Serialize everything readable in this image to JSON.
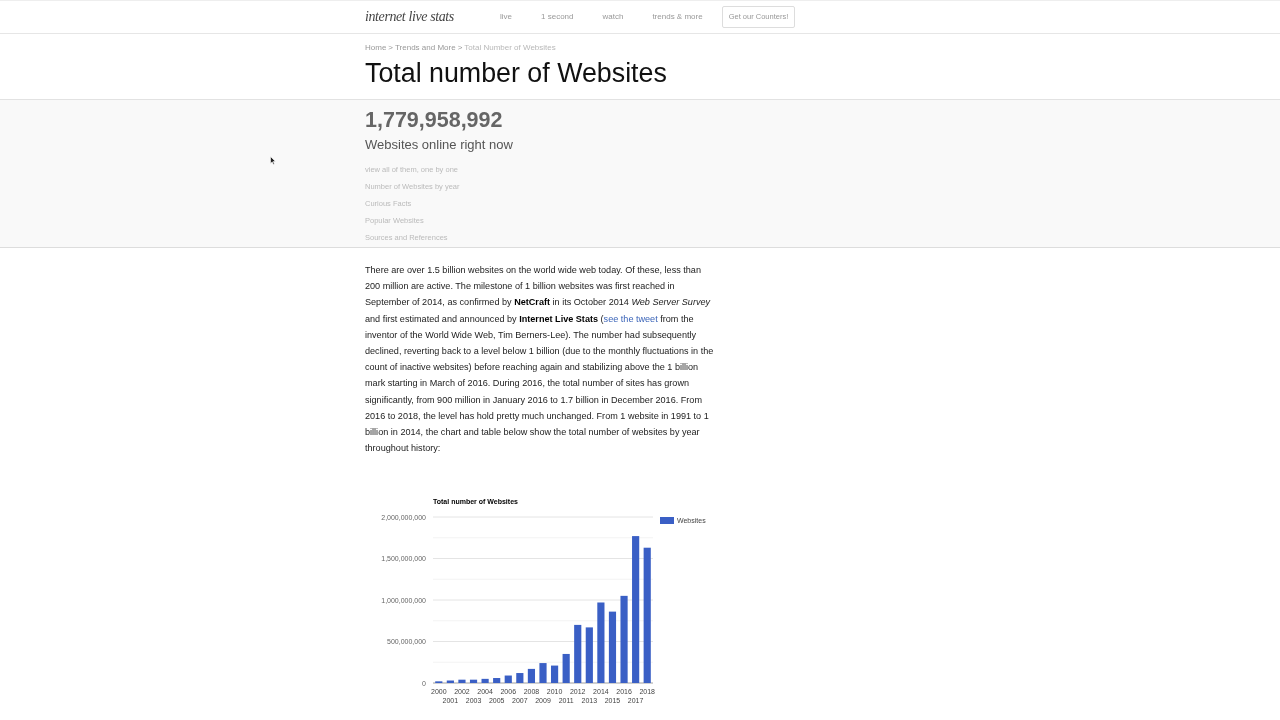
{
  "header": {
    "logo": "internet live stats",
    "nav": [
      "live",
      "1 second",
      "watch",
      "trends & more"
    ],
    "cta_button": "Get our Counters!"
  },
  "breadcrumb": {
    "separator": ">",
    "items": [
      {
        "label": "Home",
        "current": false
      },
      {
        "label": "Trends and More",
        "current": false
      },
      {
        "label": "Total Number of Websites",
        "current": true
      }
    ]
  },
  "page_title": "Total number of Websites",
  "counter": {
    "value": "1,779,958,992",
    "caption": "Websites online right now",
    "links": [
      "view all of them, one by one",
      "Number of Websites by year",
      "Curious Facts",
      "Popular Websites",
      "Sources and References"
    ]
  },
  "article": {
    "segments": [
      {
        "kind": "text",
        "text": "There are over 1.5 billion websites on the world wide web today. Of these, less than 200 million are active. The milestone of 1 billion websites was first reached in September of 2014, as confirmed by **NetCraft** in its October 2014 *Web Server Survey* and first estimated and announced by **Internet Live Stats** ("
      },
      {
        "kind": "link",
        "text": "see the tweet"
      },
      {
        "kind": "text",
        "text": " from the inventor of the World Wide Web, Tim Berners-Lee). The number had subsequently declined, reverting back to a level below 1 billion (due to the monthly fluctuations in the count of inactive websites) before reaching again and stabilizing above the 1 billion mark starting in March of 2016. During 2016, the total number of sites has grown significantly, from 900 million in January 2016 to 1.7 billion in December 2016. From 2016 to 2018, the level has hold pretty much unchanged. From 1 website in 1991 to 1 billion in 2014, the chart and table below show the total number of websites by year throughout history:"
      }
    ]
  },
  "chart": {
    "chart_data": [
      {
        "type": "bar",
        "title": "Total number of Websites",
        "categories": [
          "2000",
          "2001",
          "2002",
          "2003",
          "2004",
          "2005",
          "2006",
          "2007",
          "2008",
          "2009",
          "2010",
          "2011",
          "2012",
          "2013",
          "2014",
          "2015",
          "2016",
          "2017",
          "2018"
        ],
        "series": [
          {
            "name": "Websites",
            "color": "#3a5fc5",
            "values": [
              20000000,
              30000000,
              40000000,
              40000000,
              50000000,
              60000000,
              90000000,
              120000000,
              170000000,
              240000000,
              210000000,
              350000000,
              700000000,
              670000000,
              970000000,
              860000000,
              1050000000,
              1770000000,
              1630000000
            ]
          }
        ],
        "ylim": [
          0,
          2000000000
        ],
        "yticks": [
          {
            "value": 0,
            "label": "0"
          },
          {
            "value": 500000000,
            "label": "500,000,000"
          },
          {
            "value": 1000000000,
            "label": "1,000,000,000"
          },
          {
            "value": 1500000000,
            "label": "1,500,000,000"
          },
          {
            "value": 2000000000,
            "label": "2,000,000,000"
          }
        ],
        "grid": true,
        "legend": "right"
      }
    ]
  }
}
